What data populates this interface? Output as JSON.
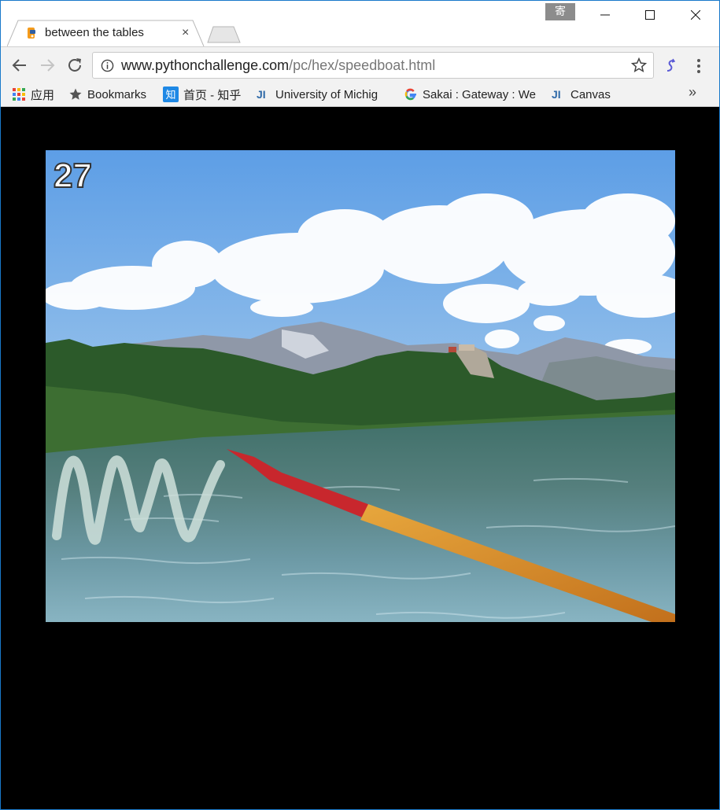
{
  "browser": {
    "ime_indicator": "寄",
    "tab": {
      "title": "between the tables",
      "close": "×"
    },
    "url": {
      "host": "www.pythonchallenge.com",
      "path": "/pc/hex/speedboat.html"
    },
    "bookmarks": [
      {
        "label": "应用",
        "icon": "apps-grid-icon"
      },
      {
        "label": "Bookmarks",
        "icon": "star-icon"
      },
      {
        "label": "首页 - 知乎",
        "icon": "zhihu-icon"
      },
      {
        "label": "University of Michig",
        "icon": "jl-icon"
      },
      {
        "label": "Sakai : Gateway : We",
        "icon": "google-icon"
      },
      {
        "label": "Canvas",
        "icon": "jl-icon"
      }
    ],
    "bookmarks_overflow": "»"
  },
  "page": {
    "image_number": "27",
    "image_description_icons": [
      "clouds",
      "mountains",
      "lake",
      "oar",
      "scribble"
    ]
  },
  "colors": {
    "accent": "#1979ca",
    "page_background": "#000000"
  }
}
